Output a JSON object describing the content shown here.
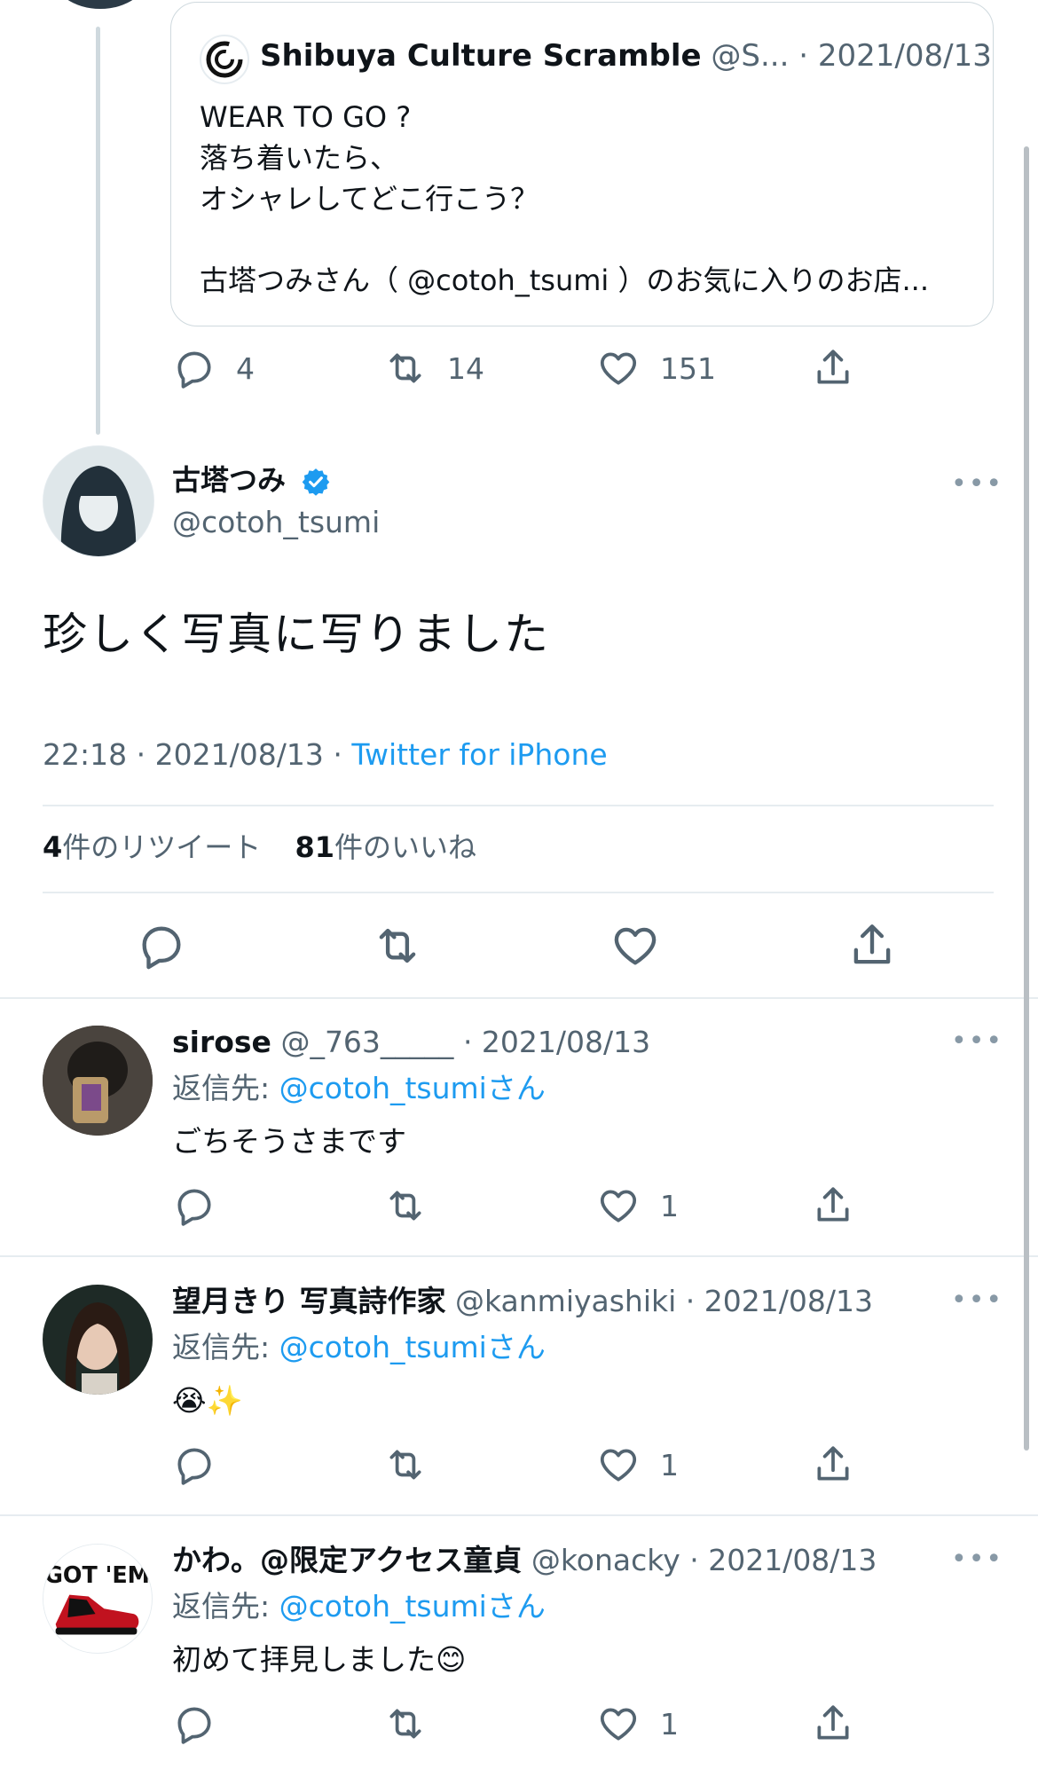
{
  "quoted_tweet": {
    "author_name": "Shibuya Culture Scramble",
    "author_handle": "@S...",
    "date": "· 2021/08/13",
    "body": "WEAR TO GO ?\n落ち着いたら、\nオシャレしてどこ行こう？\n\n古塔つみさん（ @cotoh_tsumi ）のお気に入りのお店..."
  },
  "quoted_actions": {
    "replies": "4",
    "retweets": "14",
    "likes": "151"
  },
  "main_tweet": {
    "author_name": "古塔つみ",
    "author_handle": "@cotoh_tsumi",
    "text": "珍しく写真に写りました",
    "time": "22:18",
    "date": "2021/08/13",
    "separator": "·",
    "source": "Twitter for iPhone",
    "more": "•••"
  },
  "main_counts": {
    "retweets_num": "4",
    "retweets_label": "件のリツイート",
    "likes_num": "81",
    "likes_label": "件のいいね"
  },
  "replies": [
    {
      "name": "sirose",
      "handle": "@_763_____",
      "date": "· 2021/08/13",
      "reply_to_prefix": "返信先: ",
      "reply_to_mention": "@cotoh_tsumi",
      "reply_to_suffix": "さん",
      "text": "ごちそうさまです",
      "likes": "1"
    },
    {
      "name": "望月きり 写真詩作家",
      "handle": "@kanmiyashiki",
      "date": "· 2021/08/13",
      "reply_to_prefix": "返信先: ",
      "reply_to_mention": "@cotoh_tsumi",
      "reply_to_suffix": "さん",
      "text": "😭✨",
      "likes": "1"
    },
    {
      "name": "かわ。@限定アクセス童貞",
      "handle": "@konacky",
      "date": "· 2021/08/13",
      "reply_to_prefix": "返信先: ",
      "reply_to_mention": "@cotoh_tsumi",
      "reply_to_suffix": "さん",
      "text": "初めて拝見しました😊",
      "likes": "1",
      "avatar_text": "GOT 'EM"
    }
  ],
  "colors": {
    "link": "#1d9bf0",
    "muted": "#536471",
    "border": "#e6ecf0",
    "verified": "#1d9bf0"
  },
  "icons": [
    "reply-icon",
    "retweet-icon",
    "like-icon",
    "share-icon",
    "verified-badge-icon",
    "more-icon"
  ]
}
